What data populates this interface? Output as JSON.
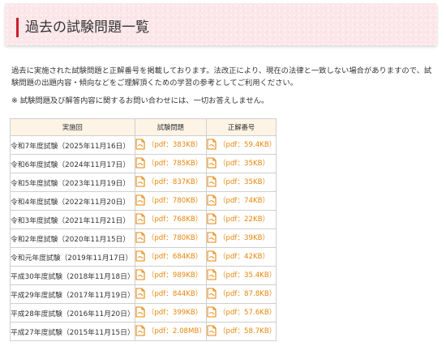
{
  "header": {
    "title": "過去の試験問題一覧",
    "accent_color": "#cc1d2e",
    "background_color": "#fbe7ea"
  },
  "intro": {
    "text": "過去に実施された試験問題と正解番号を掲載しております。法改正により、現在の法律と一致しない場合がありますので、試験問題の出題内容・傾向などをご理解頂くための学習の参考としてご利用ください。",
    "note": "※ 試験問題及び解答内容に関するお問い合わせには、一切お答えしません。"
  },
  "table": {
    "headers": [
      "実施回",
      "試験問題",
      "正解番号"
    ],
    "icon": "pdf-document-icon",
    "link_color": "#e8860c",
    "rows": [
      {
        "name": "令和7年度試験（2025年11月16日）",
        "exam": "（pdf：383KB）",
        "answer": "（pdf：59.4KB）"
      },
      {
        "name": "令和6年度試験（2024年11月17日）",
        "exam": "（pdf：785KB）",
        "answer": "（pdf：35KB）"
      },
      {
        "name": "令和5年度試験（2023年11月19日）",
        "exam": "（pdf：837KB）",
        "answer": "（pdf：35KB）"
      },
      {
        "name": "令和4年度試験（2022年11月20日）",
        "exam": "（pdf：780KB）",
        "answer": "（pdf：74KB）"
      },
      {
        "name": "令和3年度試験（2021年11月21日）",
        "exam": "（pdf：768KB）",
        "answer": "（pdf：22KB）"
      },
      {
        "name": "令和2年度試験（2020年11月15日）",
        "exam": "（pdf：780KB）",
        "answer": "（pdf：39KB）"
      },
      {
        "name": "令和元年度試験（2019年11月17日）",
        "exam": "（pdf：684KB）",
        "answer": "（pdf：42KB）"
      },
      {
        "name": "平成30年度試験（2018年11月18日）",
        "exam": "（pdf：989KB）",
        "answer": "（pdf：35.4KB）"
      },
      {
        "name": "平成29年度試験（2017年11月19日）",
        "exam": "（pdf：844KB）",
        "answer": "（pdf：87.8KB）"
      },
      {
        "name": "平成28年度試験（2016年11月20日）",
        "exam": "（pdf：399KB）",
        "answer": "（pdf：57.6KB）"
      },
      {
        "name": "平成27年度試験（2015年11月15日）",
        "exam": "（pdf：2.08MB）",
        "answer": "（pdf：58.7KB）"
      }
    ]
  }
}
